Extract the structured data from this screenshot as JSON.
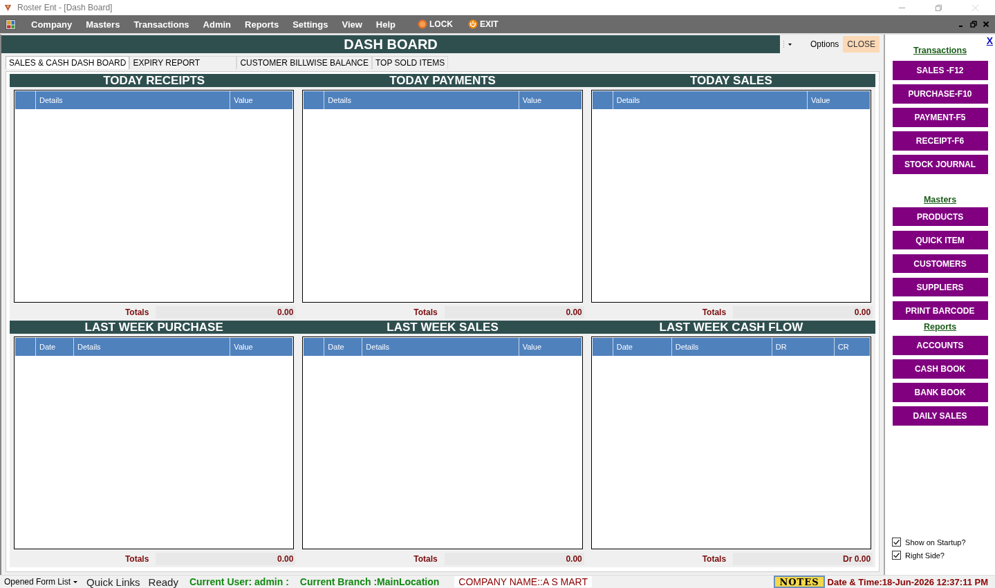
{
  "window": {
    "title": "Roster Ent - [Dash Board]"
  },
  "menu": [
    {
      "label": "Company"
    },
    {
      "label": "Masters"
    },
    {
      "label": "Transactions"
    },
    {
      "label": "Admin"
    },
    {
      "label": "Reports"
    },
    {
      "label": "Settings"
    },
    {
      "label": "View"
    },
    {
      "label": "Help"
    }
  ],
  "menu_actions": [
    {
      "label": "LOCK",
      "kind": "lock"
    },
    {
      "label": "EXIT",
      "kind": "exit"
    }
  ],
  "dashboard": {
    "title": "DASH BOARD",
    "options": "Options",
    "close": "CLOSE"
  },
  "tabs": [
    {
      "label": "SALES & CASH DASH BOARD",
      "selected": true
    },
    {
      "label": "EXPIRY REPORT",
      "selected": false
    },
    {
      "label": "CUSTOMER BILLWISE BALANCE",
      "selected": false
    },
    {
      "label": "TOP SOLD ITEMS",
      "selected": false
    }
  ],
  "panels": [
    {
      "title": "TODAY RECEIPTS",
      "columns": [
        "Details",
        "Value"
      ],
      "totals_label": "Totals",
      "total": "0.00"
    },
    {
      "title": "TODAY PAYMENTS",
      "columns": [
        "Details",
        "Value"
      ],
      "totals_label": "Totals",
      "total": "0.00"
    },
    {
      "title": "TODAY SALES",
      "columns": [
        "Details",
        "Value"
      ],
      "totals_label": "Totals",
      "total": "0.00"
    },
    {
      "title": "LAST WEEK PURCHASE",
      "columns": [
        "Date",
        "Details",
        "Value"
      ],
      "totals_label": "Totals",
      "total": "0.00"
    },
    {
      "title": "LAST WEEK SALES",
      "columns": [
        "Date",
        "Details",
        "Value"
      ],
      "totals_label": "Totals",
      "total": "0.00"
    },
    {
      "title": "LAST WEEK CASH FLOW",
      "columns": [
        "Date",
        "Details",
        "DR",
        "CR"
      ],
      "totals_label": "Totals",
      "total": "Dr 0.00"
    }
  ],
  "sidebar": {
    "close": "X",
    "sections": [
      {
        "heading": "Transactions",
        "buttons": [
          "SALES -F12",
          "PURCHASE-F10",
          "PAYMENT-F5",
          "RECEIPT-F6",
          "STOCK JOURNAL"
        ]
      },
      {
        "heading": "Masters",
        "buttons": [
          "PRODUCTS",
          "QUICK ITEM",
          "CUSTOMERS",
          "SUPPLIERS",
          "PRINT BARCODE"
        ]
      },
      {
        "heading": "Reports",
        "buttons": [
          "ACCOUNTS",
          "CASH BOOK",
          "BANK BOOK",
          "DAILY SALES"
        ]
      }
    ],
    "options": [
      {
        "label": "Show on Startup?",
        "checked": true
      },
      {
        "label": "Right Side?",
        "checked": true
      }
    ]
  },
  "status_bar": {
    "form_list": "Opened Form List",
    "items": [
      {
        "text": "Quick Links",
        "color": "#222222"
      },
      {
        "text": "Ready",
        "color": "#222222"
      },
      {
        "text": "Current User: admin :",
        "color": "#118811"
      },
      {
        "text": "Current Branch :MainLocation",
        "color": "#118811"
      },
      {
        "text": "COMPANY NAME::A S MART",
        "color": "#8b0000"
      }
    ],
    "notes": "NOTES",
    "datetime": "Date & Time:18-Jun-2026 12:37:11 PM"
  }
}
